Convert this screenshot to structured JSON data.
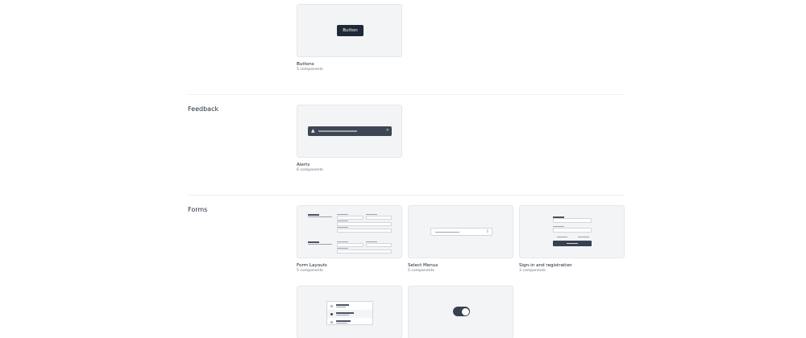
{
  "sections": {
    "feedback": {
      "title": "Feedback"
    },
    "forms": {
      "title": "Forms"
    }
  },
  "cards": {
    "buttons": {
      "title": "Buttons",
      "count": "5 components",
      "preview_label": "Button"
    },
    "alerts": {
      "title": "Alerts",
      "count": "6 components"
    },
    "form_layouts": {
      "title": "Form Layouts",
      "count": "5 components"
    },
    "select_menus": {
      "title": "Select Menus",
      "count": "5 components"
    },
    "signin": {
      "title": "Sign-in and registration",
      "count": "3 components"
    }
  },
  "colors": {
    "preview_bg": "#f3f4f6",
    "dark_accent": "#1f2937",
    "alert_bg": "#3f4653"
  },
  "icons": {
    "alert": "warning-icon",
    "close": "close-icon",
    "select": "chevron-updown-icon"
  }
}
